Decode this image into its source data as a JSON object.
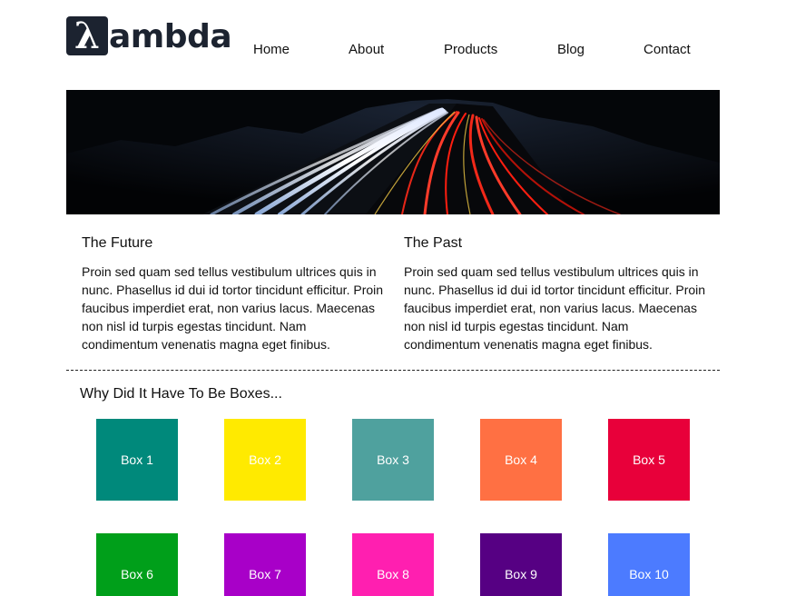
{
  "brand": {
    "logo_mark": "λ",
    "logo_text": "ambda"
  },
  "nav": {
    "items": [
      "Home",
      "About",
      "Products",
      "Blog",
      "Contact"
    ]
  },
  "hero": {
    "image": "night-highway-light-trails"
  },
  "columns": [
    {
      "title": "The Future",
      "body": "Proin sed quam sed tellus vestibulum ultrices quis in nunc. Phasellus id dui id tortor tincidunt efficitur. Proin faucibus imperdiet erat, non varius lacus. Maecenas non nisl id turpis egestas tincidunt. Nam condimentum venenatis magna eget finibus."
    },
    {
      "title": "The Past",
      "body": "Proin sed quam sed tellus vestibulum ultrices quis in nunc. Phasellus id dui id tortor tincidunt efficitur. Proin faucibus imperdiet erat, non varius lacus. Maecenas non nisl id turpis egestas tincidunt. Nam condimentum venenatis magna eget finibus."
    }
  ],
  "boxes_section": {
    "title": "Why Did It Have To Be Boxes...",
    "boxes": [
      {
        "label": "Box 1",
        "color": "#00897b"
      },
      {
        "label": "Box 2",
        "color": "#ffea00"
      },
      {
        "label": "Box 3",
        "color": "#4fa19e"
      },
      {
        "label": "Box 4",
        "color": "#ff7043"
      },
      {
        "label": "Box 5",
        "color": "#e8003a"
      },
      {
        "label": "Box 6",
        "color": "#009f1a"
      },
      {
        "label": "Box 7",
        "color": "#a800c8"
      },
      {
        "label": "Box 8",
        "color": "#ff1fb0"
      },
      {
        "label": "Box 9",
        "color": "#560083"
      },
      {
        "label": "Box 10",
        "color": "#4c7bff"
      }
    ]
  }
}
